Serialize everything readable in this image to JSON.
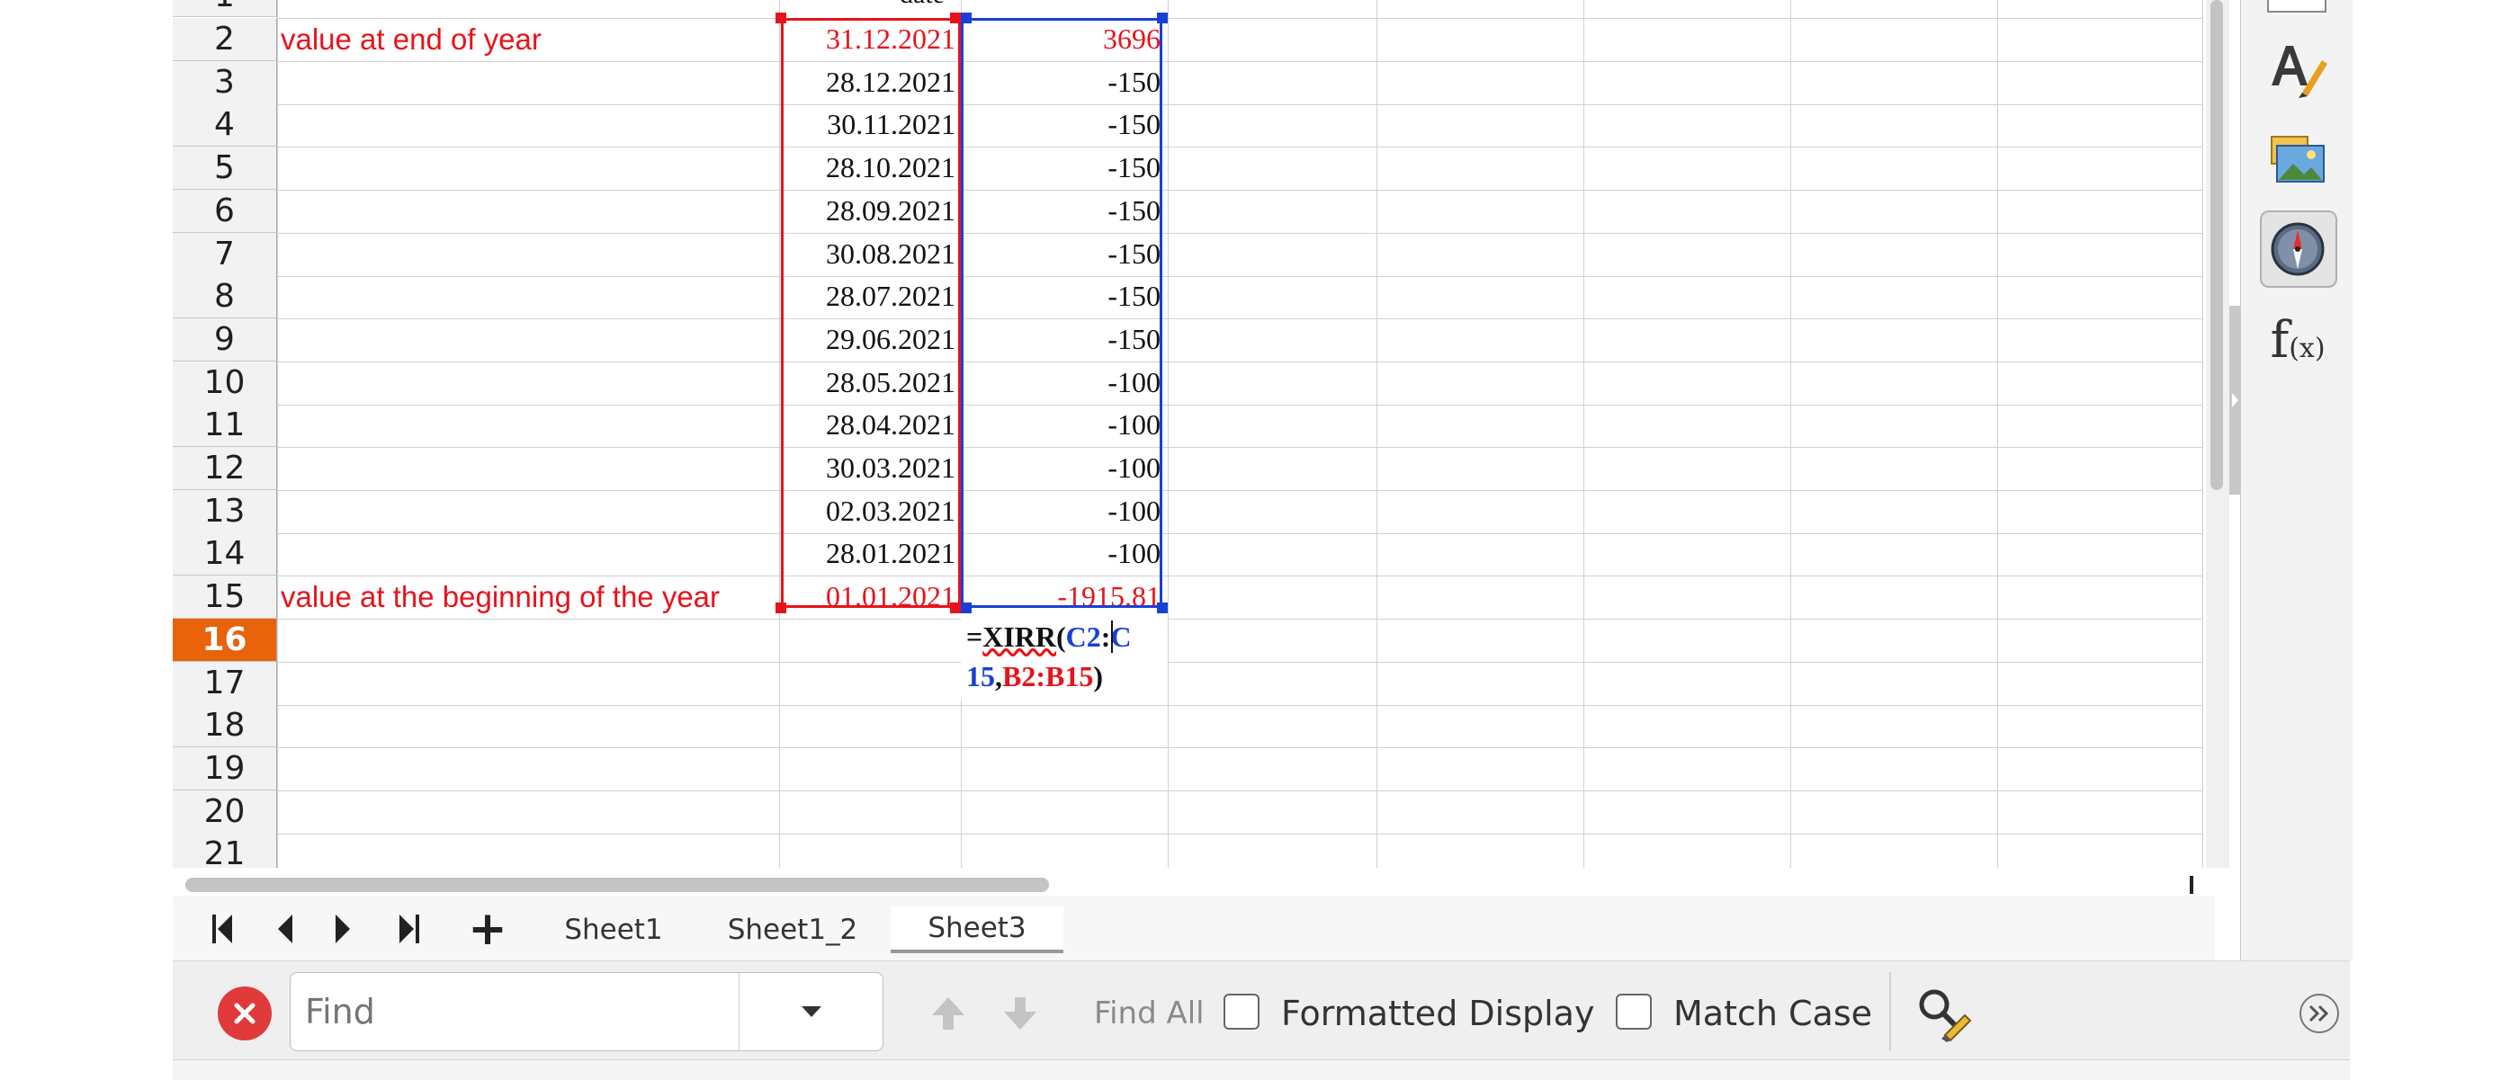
{
  "sheet": {
    "col_header_partial": "date",
    "rows": [
      {
        "num": "2",
        "a": "value at end of year",
        "b": "31.12.2021",
        "c": "3696"
      },
      {
        "num": "3",
        "a": "",
        "b": "28.12.2021",
        "c": "-150"
      },
      {
        "num": "4",
        "a": "",
        "b": "30.11.2021",
        "c": "-150"
      },
      {
        "num": "5",
        "a": "",
        "b": "28.10.2021",
        "c": "-150"
      },
      {
        "num": "6",
        "a": "",
        "b": "28.09.2021",
        "c": "-150"
      },
      {
        "num": "7",
        "a": "",
        "b": "30.08.2021",
        "c": "-150"
      },
      {
        "num": "8",
        "a": "",
        "b": "28.07.2021",
        "c": "-150"
      },
      {
        "num": "9",
        "a": "",
        "b": "29.06.2021",
        "c": "-150"
      },
      {
        "num": "10",
        "a": "",
        "b": "28.05.2021",
        "c": "-100"
      },
      {
        "num": "11",
        "a": "",
        "b": "28.04.2021",
        "c": "-100"
      },
      {
        "num": "12",
        "a": "",
        "b": "30.03.2021",
        "c": "-100"
      },
      {
        "num": "13",
        "a": "",
        "b": "02.03.2021",
        "c": "-100"
      },
      {
        "num": "14",
        "a": "",
        "b": "28.01.2021",
        "c": "-100"
      },
      {
        "num": "15",
        "a": "value at the beginning of the year",
        "b": "01.01.2021",
        "c": "-1915.81"
      },
      {
        "num": "16",
        "a": "",
        "b": "",
        "c": ""
      },
      {
        "num": "17",
        "a": "",
        "b": "",
        "c": ""
      },
      {
        "num": "18",
        "a": "",
        "b": "",
        "c": ""
      },
      {
        "num": "19",
        "a": "",
        "b": "",
        "c": ""
      },
      {
        "num": "20",
        "a": "",
        "b": "",
        "c": ""
      },
      {
        "num": "21",
        "a": "",
        "b": "",
        "c": ""
      }
    ],
    "active_row": "16",
    "formula": {
      "eq": "=",
      "fn": "XIRR",
      "open": "(",
      "ref1a": "C2",
      "colon1": ":",
      "ref1b_line1": "C",
      "ref1b_line2": "15",
      "comma": ",",
      "ref2": "B2:B15",
      "close": ")"
    }
  },
  "tabs": {
    "nav_first": "first-sheet",
    "nav_prev": "prev-sheet",
    "nav_next": "next-sheet",
    "nav_last": "last-sheet",
    "add": "+",
    "items": [
      "Sheet1",
      "Sheet1_2",
      "Sheet3"
    ],
    "active": "Sheet3"
  },
  "findbar": {
    "placeholder": "Find",
    "find_all": "Find All",
    "formatted_display": "Formatted Display",
    "match_case": "Match Case"
  },
  "sidebar": {
    "icons": [
      "character-icon",
      "gallery-icon",
      "navigator-icon",
      "functions-icon"
    ],
    "functions_label": "f(x)"
  },
  "colors": {
    "accent": "#e8630a",
    "ref_red": "#e8131a",
    "ref_blue": "#1a3fd6"
  }
}
